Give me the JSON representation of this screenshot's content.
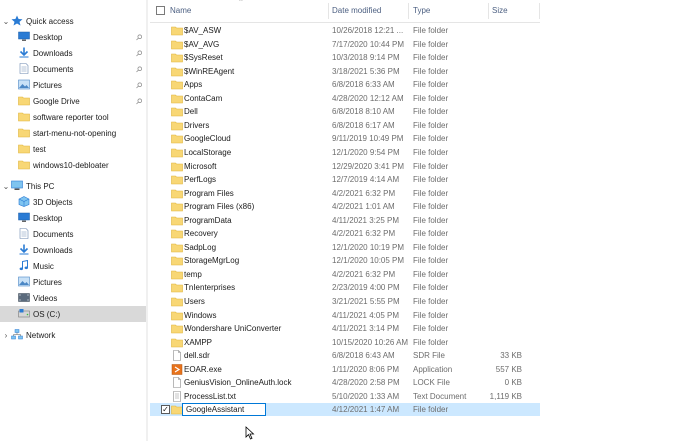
{
  "nav": {
    "quick_access": "Quick access",
    "quick_items": [
      {
        "label": "Desktop",
        "icon": "desktop-icon",
        "pinned": true
      },
      {
        "label": "Downloads",
        "icon": "downloads-icon",
        "pinned": true
      },
      {
        "label": "Documents",
        "icon": "documents-icon",
        "pinned": true
      },
      {
        "label": "Pictures",
        "icon": "pictures-icon",
        "pinned": true
      },
      {
        "label": "Google Drive",
        "icon": "folder-icon",
        "pinned": true
      },
      {
        "label": "software reporter tool",
        "icon": "folder-icon",
        "pinned": false
      },
      {
        "label": "start-menu-not-opening",
        "icon": "folder-icon",
        "pinned": false
      },
      {
        "label": "test",
        "icon": "folder-icon",
        "pinned": false
      },
      {
        "label": "windows10-debloater",
        "icon": "folder-icon",
        "pinned": false
      }
    ],
    "this_pc": "This PC",
    "pc_items": [
      {
        "label": "3D Objects",
        "icon": "3d-objects-icon"
      },
      {
        "label": "Desktop",
        "icon": "desktop-icon"
      },
      {
        "label": "Documents",
        "icon": "documents-icon"
      },
      {
        "label": "Downloads",
        "icon": "downloads-icon"
      },
      {
        "label": "Music",
        "icon": "music-icon"
      },
      {
        "label": "Pictures",
        "icon": "pictures-icon"
      },
      {
        "label": "Videos",
        "icon": "videos-icon"
      },
      {
        "label": "OS (C:)",
        "icon": "drive-icon"
      }
    ],
    "network": "Network"
  },
  "columns": {
    "name": "Name",
    "date": "Date modified",
    "type": "Type",
    "size": "Size"
  },
  "files": [
    {
      "name": "$AV_ASW",
      "date": "10/26/2018 12:21 ...",
      "type": "File folder",
      "size": "",
      "kind": "folder"
    },
    {
      "name": "$AV_AVG",
      "date": "7/17/2020 10:44 PM",
      "type": "File folder",
      "size": "",
      "kind": "folder"
    },
    {
      "name": "$SysReset",
      "date": "10/3/2018 9:14 PM",
      "type": "File folder",
      "size": "",
      "kind": "folder"
    },
    {
      "name": "$WinREAgent",
      "date": "3/18/2021 5:36 PM",
      "type": "File folder",
      "size": "",
      "kind": "folder"
    },
    {
      "name": "Apps",
      "date": "6/8/2018 6:33 AM",
      "type": "File folder",
      "size": "",
      "kind": "folder"
    },
    {
      "name": "ContaCam",
      "date": "4/28/2020 12:12 AM",
      "type": "File folder",
      "size": "",
      "kind": "folder"
    },
    {
      "name": "Dell",
      "date": "6/8/2018 8:10 AM",
      "type": "File folder",
      "size": "",
      "kind": "folder"
    },
    {
      "name": "Drivers",
      "date": "6/8/2018 6:17 AM",
      "type": "File folder",
      "size": "",
      "kind": "folder"
    },
    {
      "name": "GoogleCloud",
      "date": "9/11/2019 10:49 PM",
      "type": "File folder",
      "size": "",
      "kind": "folder"
    },
    {
      "name": "LocalStorage",
      "date": "12/1/2020 9:54 PM",
      "type": "File folder",
      "size": "",
      "kind": "folder"
    },
    {
      "name": "Microsoft",
      "date": "12/29/2020 3:41 PM",
      "type": "File folder",
      "size": "",
      "kind": "folder"
    },
    {
      "name": "PerfLogs",
      "date": "12/7/2019 4:14 AM",
      "type": "File folder",
      "size": "",
      "kind": "folder"
    },
    {
      "name": "Program Files",
      "date": "4/2/2021 6:32 PM",
      "type": "File folder",
      "size": "",
      "kind": "folder"
    },
    {
      "name": "Program Files (x86)",
      "date": "4/2/2021 1:01 AM",
      "type": "File folder",
      "size": "",
      "kind": "folder"
    },
    {
      "name": "ProgramData",
      "date": "4/11/2021 3:25 PM",
      "type": "File folder",
      "size": "",
      "kind": "folder"
    },
    {
      "name": "Recovery",
      "date": "4/2/2021 6:32 PM",
      "type": "File folder",
      "size": "",
      "kind": "folder"
    },
    {
      "name": "SadpLog",
      "date": "12/1/2020 10:19 PM",
      "type": "File folder",
      "size": "",
      "kind": "folder"
    },
    {
      "name": "StorageMgrLog",
      "date": "12/1/2020 10:05 PM",
      "type": "File folder",
      "size": "",
      "kind": "folder"
    },
    {
      "name": "temp",
      "date": "4/2/2021 6:32 PM",
      "type": "File folder",
      "size": "",
      "kind": "folder"
    },
    {
      "name": "TnIenterprises",
      "date": "2/23/2019 4:00 PM",
      "type": "File folder",
      "size": "",
      "kind": "folder"
    },
    {
      "name": "Users",
      "date": "3/21/2021 5:55 PM",
      "type": "File folder",
      "size": "",
      "kind": "folder"
    },
    {
      "name": "Windows",
      "date": "4/11/2021 4:05 PM",
      "type": "File folder",
      "size": "",
      "kind": "folder"
    },
    {
      "name": "Wondershare UniConverter",
      "date": "4/11/2021 3:14 PM",
      "type": "File folder",
      "size": "",
      "kind": "folder"
    },
    {
      "name": "XAMPP",
      "date": "10/15/2020 10:26 AM",
      "type": "File folder",
      "size": "",
      "kind": "folder"
    },
    {
      "name": "dell.sdr",
      "date": "6/8/2018 6:43 AM",
      "type": "SDR File",
      "size": "33 KB",
      "kind": "file"
    },
    {
      "name": "EOAR.exe",
      "date": "1/11/2020 8:06 PM",
      "type": "Application",
      "size": "557 KB",
      "kind": "exe"
    },
    {
      "name": "GeniusVision_OnlineAuth.lock",
      "date": "4/28/2020 2:58 PM",
      "type": "LOCK File",
      "size": "0 KB",
      "kind": "file"
    },
    {
      "name": "ProcessList.txt",
      "date": "5/10/2020 1:33 AM",
      "type": "Text Document",
      "size": "1,119 KB",
      "kind": "txt"
    },
    {
      "name": "GoogleAssistant",
      "date": "4/12/2021 1:47 AM",
      "type": "File folder",
      "size": "",
      "kind": "folder",
      "renaming": true
    }
  ],
  "colors": {
    "folder": "#f8d775",
    "folder_dark": "#e0b53b",
    "selection": "#cce8ff",
    "drive_highlight": "#d9d9d9",
    "accent": "#0078d7"
  }
}
